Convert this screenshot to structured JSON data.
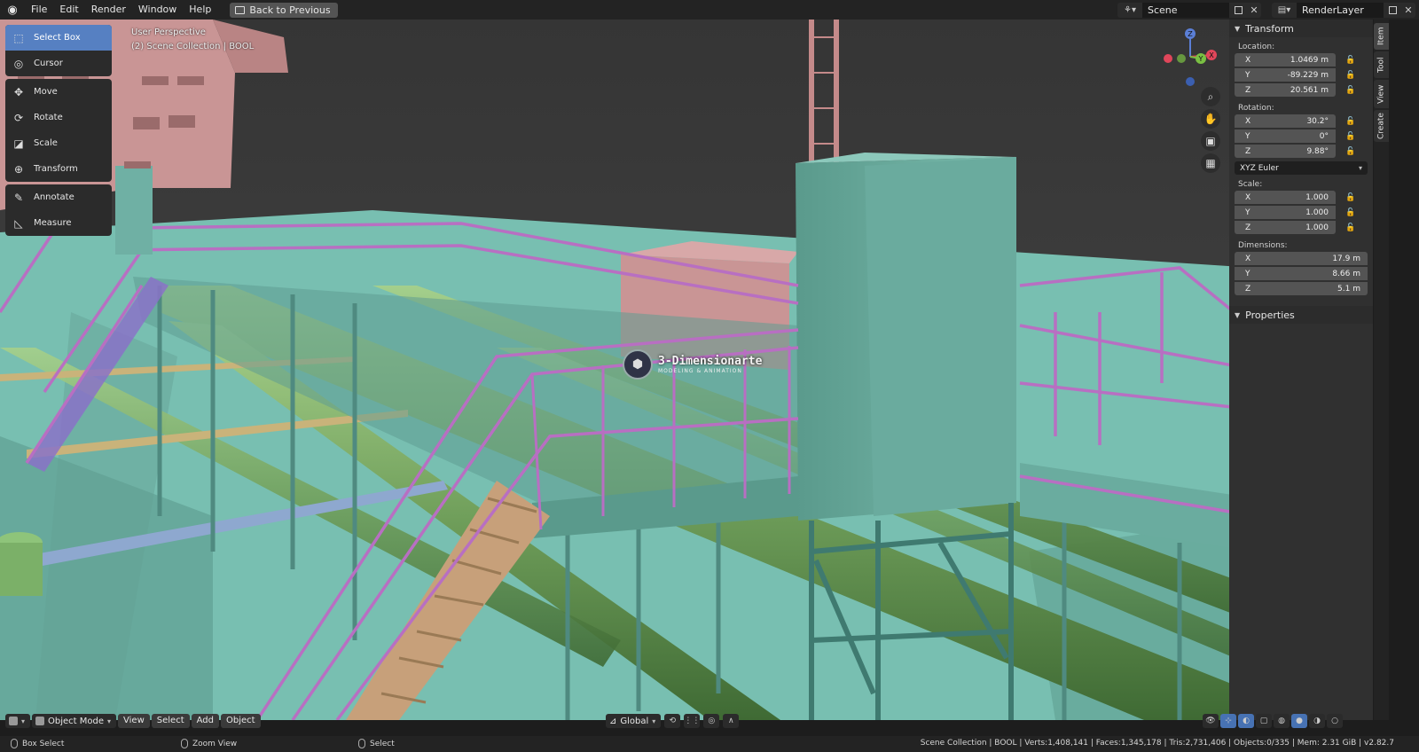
{
  "topbar": {
    "menus": [
      "File",
      "Edit",
      "Render",
      "Window",
      "Help"
    ],
    "back_button": "Back to Previous",
    "scene_name": "Scene",
    "render_layer": "RenderLayer"
  },
  "viewport": {
    "perspective_label": "User Perspective",
    "collection_label": "(2) Scene Collection | BOOL"
  },
  "toolbar": {
    "tools": [
      {
        "label": "Select Box",
        "icon": "select-box-icon"
      },
      {
        "label": "Cursor",
        "icon": "cursor-icon"
      },
      {
        "label": "Move",
        "icon": "move-icon"
      },
      {
        "label": "Rotate",
        "icon": "rotate-icon"
      },
      {
        "label": "Scale",
        "icon": "scale-icon"
      },
      {
        "label": "Transform",
        "icon": "transform-icon"
      },
      {
        "label": "Annotate",
        "icon": "annotate-icon"
      },
      {
        "label": "Measure",
        "icon": "measure-icon"
      }
    ]
  },
  "gizmo": {
    "x": "X",
    "y": "Y",
    "z": "Z"
  },
  "watermark": {
    "title": "3-Dimensionarte",
    "subtitle": "MODELING & ANIMATION"
  },
  "footer": {
    "mode": "Object Mode",
    "view": "View",
    "select": "Select",
    "add": "Add",
    "object": "Object",
    "orientation": "Global"
  },
  "npanel": {
    "transform_title": "Transform",
    "location_label": "Location:",
    "location": {
      "x": "1.0469 m",
      "y": "-89.229 m",
      "z": "20.561 m"
    },
    "rotation_label": "Rotation:",
    "rotation": {
      "x": "30.2°",
      "y": "0°",
      "z": "9.88°"
    },
    "rotation_mode": "XYZ Euler",
    "scale_label": "Scale:",
    "scale": {
      "x": "1.000",
      "y": "1.000",
      "z": "1.000"
    },
    "dimensions_label": "Dimensions:",
    "dimensions": {
      "x": "17.9 m",
      "y": "8.66 m",
      "z": "5.1 m"
    },
    "properties_title": "Properties",
    "axis": {
      "x": "X",
      "y": "Y",
      "z": "Z"
    }
  },
  "tabs": [
    "Item",
    "Tool",
    "View",
    "Create"
  ],
  "statusbar": {
    "left": "Box Select",
    "middle": "Zoom View",
    "right": "Select",
    "stats": "Scene Collection | BOOL | Verts:1,408,141 | Faces:1,345,178 | Tris:2,731,406 | Objects:0/335 | Mem: 2.31 GiB | v2.82.7"
  },
  "colors": {
    "accent": "#5680c2",
    "deck": "#6fb5a8",
    "pipe_green": "#7fb06a",
    "rail_purple": "#a86ab5",
    "superstructure_pink": "#c98e8e",
    "sky": "#3c3c3c"
  }
}
